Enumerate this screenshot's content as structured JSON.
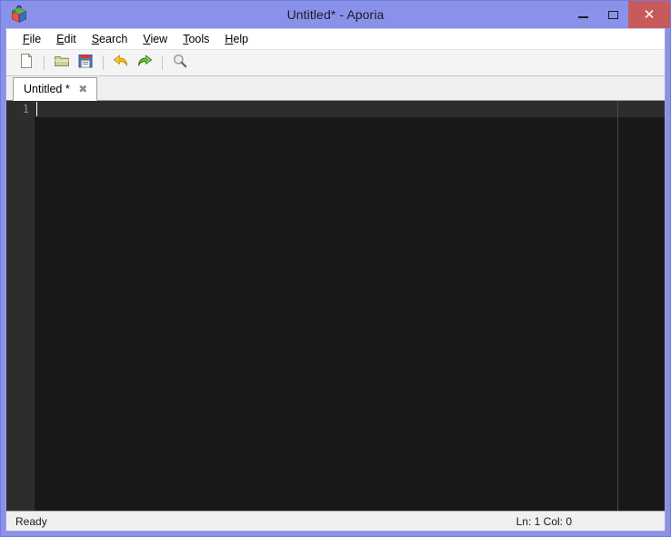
{
  "window": {
    "title": "Untitled* - Aporia",
    "icon": "app-cube-icon",
    "frame_color": "#8a91e8",
    "titlebar_color": "#8a91e8",
    "controls": {
      "minimize_label": "–",
      "maximize_label": "□",
      "close_label": "✕",
      "close_color": "#c75b5b"
    }
  },
  "menubar": {
    "items": [
      {
        "label": "File",
        "accel": "F",
        "rest": "ile"
      },
      {
        "label": "Edit",
        "accel": "E",
        "rest": "dit"
      },
      {
        "label": "Search",
        "accel": "S",
        "rest": "earch"
      },
      {
        "label": "View",
        "accel": "V",
        "rest": "iew"
      },
      {
        "label": "Tools",
        "accel": "T",
        "rest": "ools"
      },
      {
        "label": "Help",
        "accel": "H",
        "rest": "elp"
      }
    ]
  },
  "toolbar": {
    "buttons": [
      {
        "name": "new-file-icon",
        "tooltip": "New"
      },
      {
        "name": "open-file-icon",
        "tooltip": "Open"
      },
      {
        "name": "save-file-icon",
        "tooltip": "Save"
      },
      {
        "name": "undo-icon",
        "tooltip": "Undo"
      },
      {
        "name": "redo-icon",
        "tooltip": "Redo"
      },
      {
        "name": "search-icon",
        "tooltip": "Find"
      }
    ]
  },
  "tabs": {
    "items": [
      {
        "label": "Untitled *",
        "close_label": "✖",
        "active": true
      }
    ]
  },
  "editor": {
    "background": "#191919",
    "gutter_background": "#2d2d2d",
    "current_line_color": "#2d2d2d",
    "line_numbers": [
      "1"
    ],
    "lines": [
      ""
    ],
    "caret_visible": true,
    "margin_guide_column_x": 641
  },
  "statusbar": {
    "message": "Ready",
    "position": "Ln: 1 Col: 0"
  }
}
